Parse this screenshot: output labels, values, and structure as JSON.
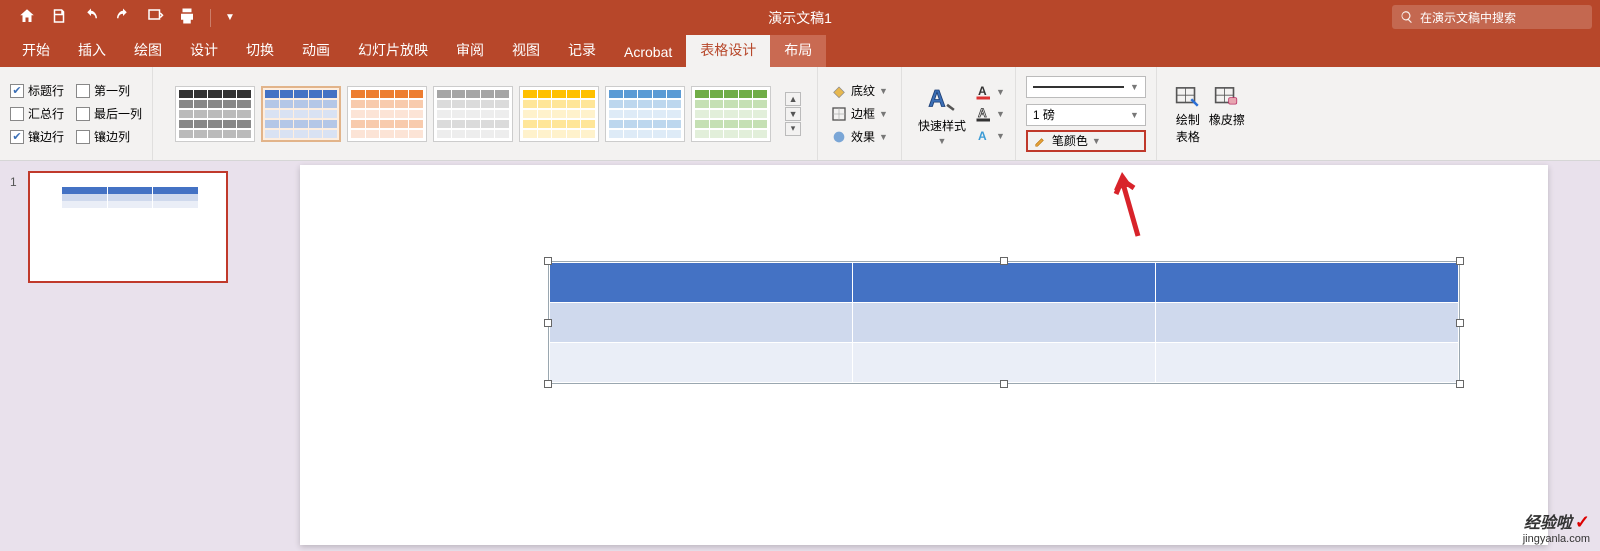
{
  "app": {
    "title": "演示文稿1",
    "search_placeholder": "在演示文稿中搜索"
  },
  "tabs": {
    "start": "开始",
    "insert": "插入",
    "draw": "绘图",
    "design": "设计",
    "transition": "切换",
    "animation": "动画",
    "slideshow": "幻灯片放映",
    "review": "审阅",
    "view": "视图",
    "record": "记录",
    "acrobat": "Acrobat",
    "table_design": "表格设计",
    "layout": "布局"
  },
  "options": {
    "header_row": "标题行",
    "total_row": "汇总行",
    "banded_row": "镶边行",
    "first_col": "第一列",
    "last_col": "最后一列",
    "banded_col": "镶边列"
  },
  "shading": {
    "shading": "底纹",
    "border": "边框",
    "effects": "效果"
  },
  "wordart": {
    "quick_styles": "快速样式"
  },
  "pen": {
    "weight": "1 磅",
    "color": "笔颜色",
    "draw_table": "绘制\n表格",
    "eraser": "橡皮擦"
  },
  "slide": {
    "number": "1"
  },
  "watermark": {
    "brand": "经验啦",
    "site": "jingyanla.com"
  }
}
